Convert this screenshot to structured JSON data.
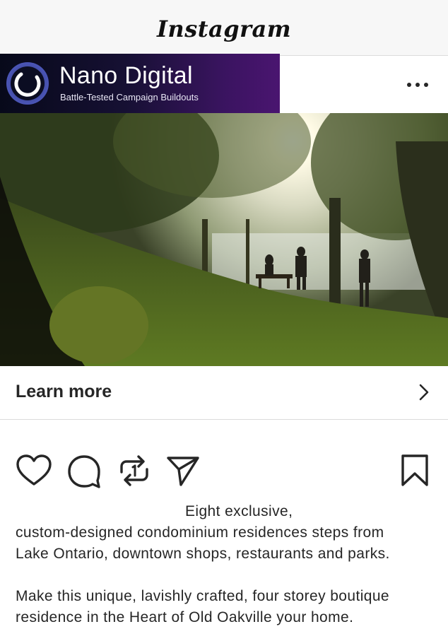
{
  "app": {
    "title": "Instagram"
  },
  "ad": {
    "brand_name": "Nano Digital",
    "brand_tagline": "Battle-Tested Campaign Buildouts",
    "more_icon": "more-horizontal-icon"
  },
  "media": {
    "description_icon": "photo"
  },
  "cta": {
    "label": "Learn more",
    "icon": "chevron-right-icon"
  },
  "actions": {
    "like_icon": "heart-icon",
    "comment_icon": "comment-icon",
    "repost_icon": "repost-icon",
    "share_icon": "send-icon",
    "save_icon": "bookmark-icon"
  },
  "caption": {
    "line1": "Eight exclusive,",
    "line2": "custom-designed condominium residences steps from",
    "line3": "Lake Ontario, downtown shops, restaurants and parks.",
    "line4": "Make this unique, lavishly crafted, four storey boutique",
    "line5": "residence in the Heart of Old Oakville your home."
  },
  "colors": {
    "text": "#262626",
    "banner_start": "#07091a",
    "banner_end": "#4a1570",
    "topbar_bg": "#f7f7f7"
  }
}
